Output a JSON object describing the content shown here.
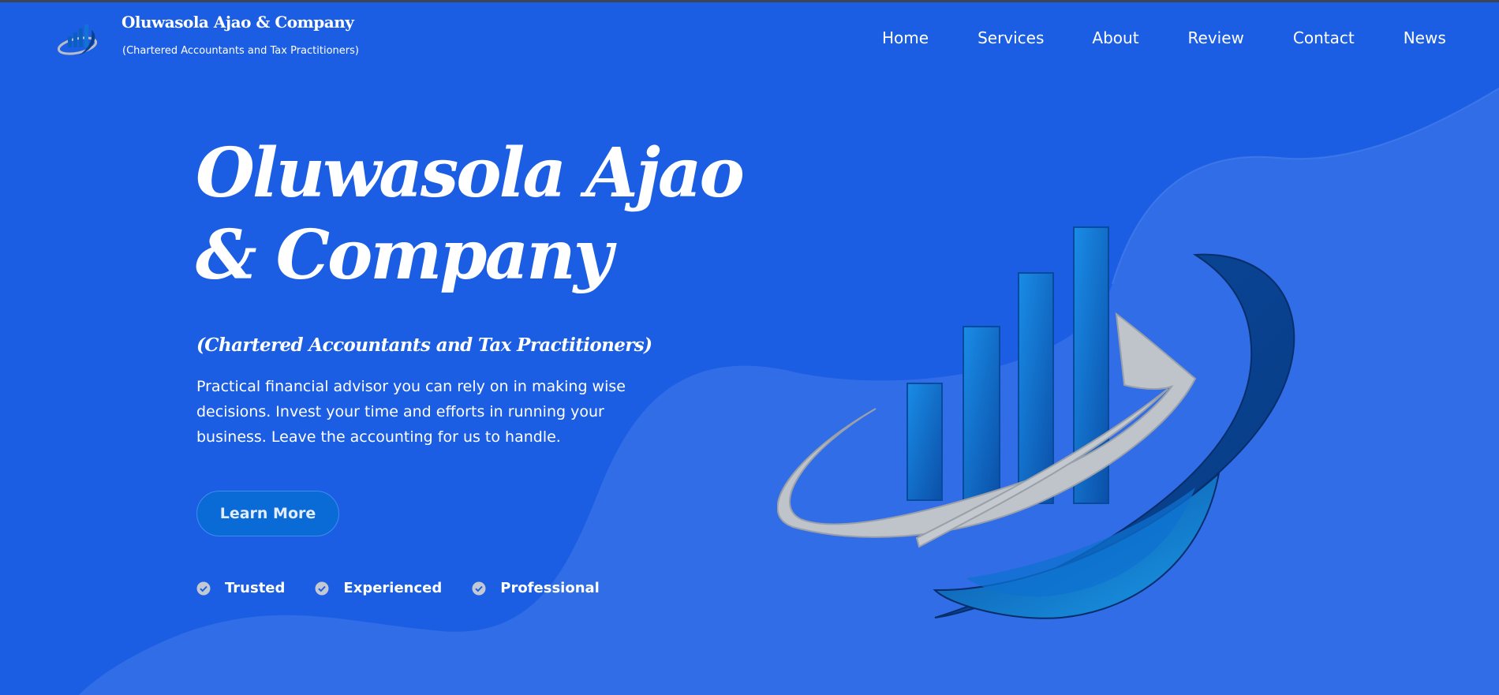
{
  "brand": {
    "title": "Oluwasola Ajao & Company",
    "subtitle": "(Chartered Accountants and Tax Practitioners)",
    "logo_icon": "bar-chart-swoosh-logo"
  },
  "nav": {
    "items": [
      {
        "label": "Home"
      },
      {
        "label": "Services"
      },
      {
        "label": "About"
      },
      {
        "label": "Review"
      },
      {
        "label": "Contact"
      },
      {
        "label": "News"
      }
    ]
  },
  "hero": {
    "title_line1": "Oluwasola Ajao",
    "title_line2": "& Company",
    "subtitle": "(Chartered Accountants and Tax Practitioners)",
    "description": "Practical financial advisor you can rely on in making wise decisions. Invest your time and efforts in running your business. Leave the accounting for us to handle.",
    "cta_label": "Learn More",
    "badges": [
      {
        "label": "Trusted",
        "icon": "check-circle-icon"
      },
      {
        "label": "Experienced",
        "icon": "check-circle-icon"
      },
      {
        "label": "Professional",
        "icon": "check-circle-icon"
      }
    ]
  },
  "colors": {
    "background": "#1c5ee3",
    "wave": "#3470e6",
    "button": "#0a6bd6",
    "logo_bars": "#0b5fbe",
    "logo_swoosh": "#c0c4cc",
    "logo_ring": "#0a3f8c"
  }
}
